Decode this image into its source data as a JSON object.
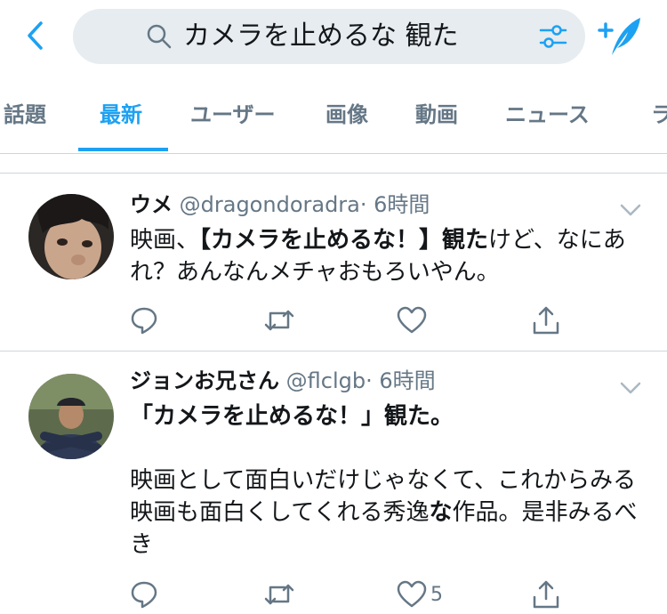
{
  "search": {
    "query": "カメラを止めるな 観た"
  },
  "tabs": [
    {
      "label": "話題"
    },
    {
      "label": "最新"
    },
    {
      "label": "ユーザー"
    },
    {
      "label": "画像"
    },
    {
      "label": "動画"
    },
    {
      "label": "ニュース"
    },
    {
      "label": "ラ"
    }
  ],
  "active_tab": "最新",
  "tweets": [
    {
      "name": "ウメ",
      "handle": "@dragondoradra",
      "time": "· 6時間",
      "segments": [
        {
          "t": "映画、",
          "b": false
        },
        {
          "t": "【カメラを止めるな！】観た",
          "b": true
        },
        {
          "t": "けど、なにあれ？あんなんメチャおもろいやん。",
          "b": false
        }
      ],
      "likes": ""
    },
    {
      "name": "ジョンお兄さん",
      "handle": "@flclgb",
      "time": "· 6時間",
      "segments": [
        {
          "t": "「カメラを止めるな！」観た。",
          "b": true
        },
        {
          "t": "\n\n映画として面白いだけじゃなくて、これからみる映画も面白くしてくれる秀逸",
          "b": false
        },
        {
          "t": "な",
          "b": true
        },
        {
          "t": "作品。是非みるべき",
          "b": false
        }
      ],
      "likes": "5"
    }
  ],
  "colors": {
    "accent": "#1da1f2",
    "muted": "#657786",
    "search_bg": "#e6ecf0"
  },
  "icons": [
    "back-chevron-icon",
    "search-icon",
    "filter-icon",
    "compose-tweet-icon",
    "reply-icon",
    "retweet-icon",
    "like-icon",
    "share-icon",
    "caret-down-icon"
  ]
}
